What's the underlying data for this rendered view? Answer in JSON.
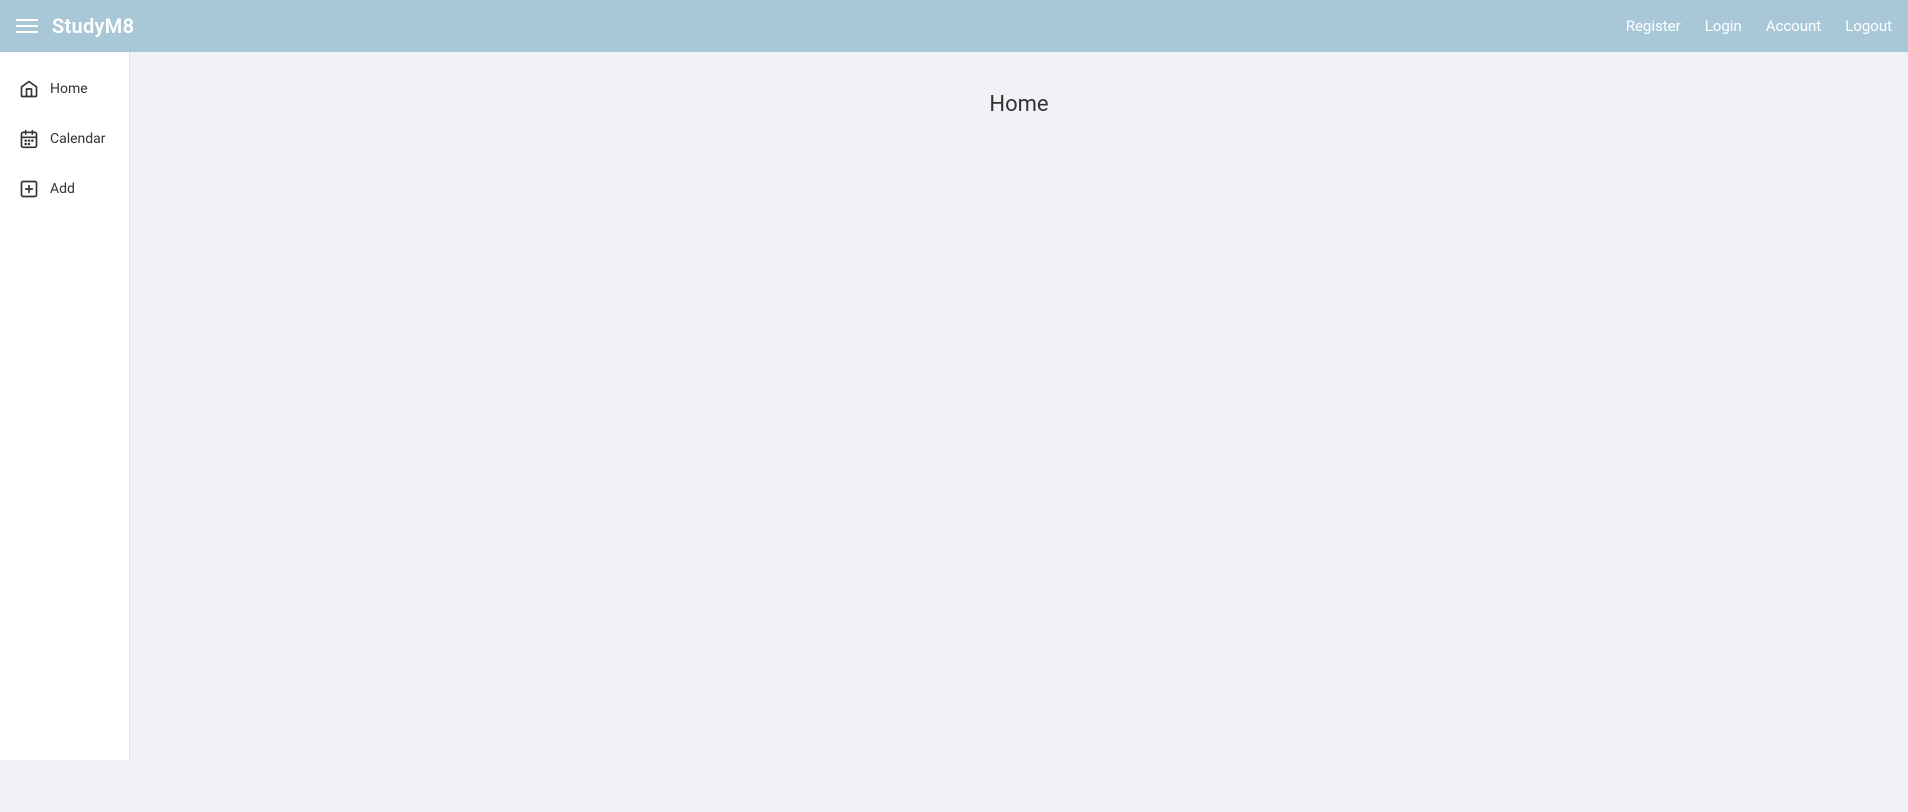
{
  "navbar": {
    "app_title": "StudyM8",
    "nav_links": [
      {
        "key": "register",
        "label": "Register"
      },
      {
        "key": "login",
        "label": "Login"
      },
      {
        "key": "account",
        "label": "Account"
      },
      {
        "key": "logout",
        "label": "Logout"
      }
    ]
  },
  "sidebar": {
    "items": [
      {
        "key": "home",
        "label": "Home",
        "icon": "home-icon"
      },
      {
        "key": "calendar",
        "label": "Calendar",
        "icon": "calendar-icon"
      },
      {
        "key": "add",
        "label": "Add",
        "icon": "add-icon"
      }
    ]
  },
  "main": {
    "page_heading": "Home"
  },
  "colors": {
    "navbar_bg": "#a8c8d8",
    "sidebar_bg": "#ffffff",
    "main_bg": "#f0f2f5"
  }
}
